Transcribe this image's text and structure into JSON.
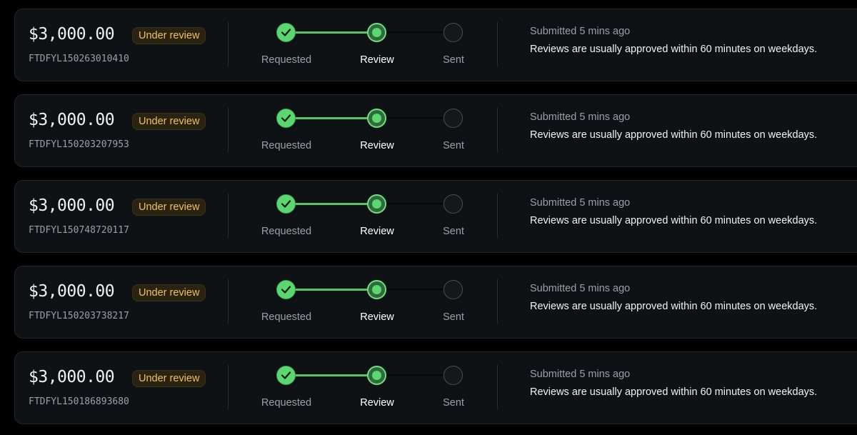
{
  "steps": {
    "requested": "Requested",
    "review": "Review",
    "sent": "Sent"
  },
  "icons": {
    "step_complete": "checkmark-icon",
    "step_current": "dot-icon"
  },
  "colors": {
    "accent_green": "#5cd66f",
    "badge_text": "#f0c05a",
    "card_bg": "#0f1215"
  },
  "withdrawals": [
    {
      "amount": "$3,000.00",
      "status": "Under review",
      "id": "FTDFYL150263010410",
      "submitted": "Submitted 5 mins ago",
      "note": "Reviews are usually approved within 60 minutes on weekdays."
    },
    {
      "amount": "$3,000.00",
      "status": "Under review",
      "id": "FTDFYL150203207953",
      "submitted": "Submitted 5 mins ago",
      "note": "Reviews are usually approved within 60 minutes on weekdays."
    },
    {
      "amount": "$3,000.00",
      "status": "Under review",
      "id": "FTDFYL150748720117",
      "submitted": "Submitted 5 mins ago",
      "note": "Reviews are usually approved within 60 minutes on weekdays."
    },
    {
      "amount": "$3,000.00",
      "status": "Under review",
      "id": "FTDFYL150203738217",
      "submitted": "Submitted 5 mins ago",
      "note": "Reviews are usually approved within 60 minutes on weekdays."
    },
    {
      "amount": "$3,000.00",
      "status": "Under review",
      "id": "FTDFYL150186893680",
      "submitted": "Submitted 5 mins ago",
      "note": "Reviews are usually approved within 60 minutes on weekdays."
    }
  ]
}
